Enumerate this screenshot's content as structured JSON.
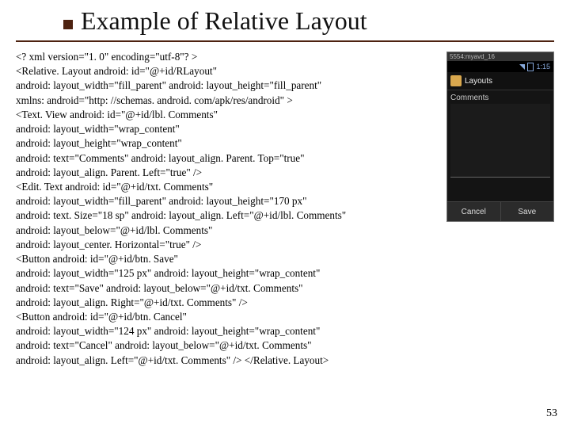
{
  "title": "Example of Relative Layout",
  "code_lines": [
    "<? xml version=\"1. 0\" encoding=\"utf-8\"? >",
    "<Relative. Layout android: id=\"@+id/RLayout\"",
    "android: layout_width=\"fill_parent\" android: layout_height=\"fill_parent\"",
    "xmlns: android=\"http: //schemas. android. com/apk/res/android\" >",
    "<Text. View android: id=\"@+id/lbl. Comments\"",
    "android: layout_width=\"wrap_content\"",
    "android: layout_height=\"wrap_content\"",
    "android: text=\"Comments\" android: layout_align. Parent. Top=\"true\"",
    "android: layout_align. Parent. Left=\"true\" />",
    "<Edit. Text android: id=\"@+id/txt. Comments\"",
    "android: layout_width=\"fill_parent\" android: layout_height=\"170 px\"",
    "android: text. Size=\"18 sp\" android: layout_align. Left=\"@+id/lbl. Comments\"",
    "android: layout_below=\"@+id/lbl. Comments\"",
    "android: layout_center. Horizontal=\"true\" />",
    "<Button android: id=\"@+id/btn. Save\"",
    "android: layout_width=\"125 px\" android: layout_height=\"wrap_content\"",
    "android: text=\"Save\" android: layout_below=\"@+id/txt. Comments\"",
    "android: layout_align. Right=\"@+id/txt. Comments\" />",
    "<Button android: id=\"@+id/btn. Cancel\"",
    "android: layout_width=\"124 px\" android: layout_height=\"wrap_content\"",
    "android: text=\"Cancel\" android: layout_below=\"@+id/txt. Comments\"",
    "android: layout_align. Left=\"@+id/txt. Comments\" /> </Relative. Layout>"
  ],
  "phone": {
    "emu_label": "5554:myavd_16",
    "time": "1:15",
    "app_title": "Layouts",
    "field_label": "Comments",
    "btn_cancel": "Cancel",
    "btn_save": "Save"
  },
  "page_number": "53"
}
